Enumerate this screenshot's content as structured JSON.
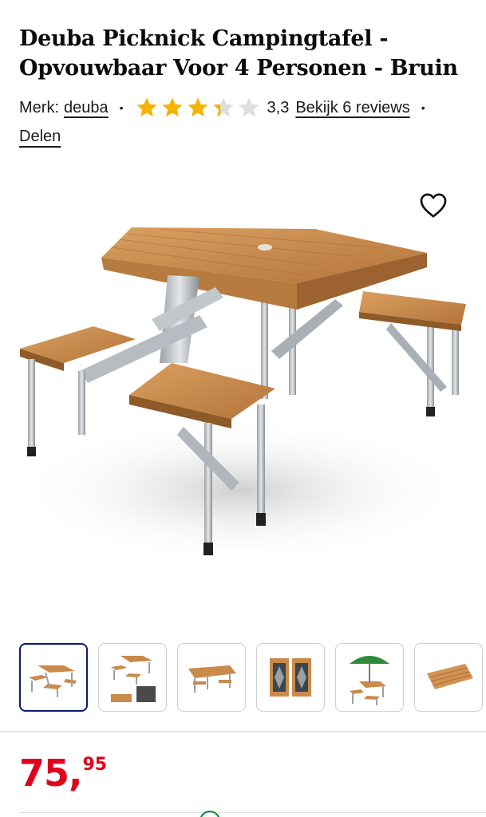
{
  "product": {
    "title": "Deuba Picknick Campingtafel - Opvouwbaar Voor 4 Personen - Bruin",
    "brand_label": "Merk:",
    "brand": "deuba",
    "rating": 3.3,
    "rating_text": "3,3",
    "reviews_link": "Bekijk 6 reviews",
    "share_label": "Delen"
  },
  "gallery": {
    "main_image": "picnic-table-photo",
    "wishlist_icon": "heart-outline-icon",
    "thumbnails": [
      {
        "name": "thumbnail-1",
        "subject": "table-with-benches",
        "active": true
      },
      {
        "name": "thumbnail-2",
        "subject": "table-and-detail-views",
        "active": false
      },
      {
        "name": "thumbnail-3",
        "subject": "table-side-view",
        "active": false
      },
      {
        "name": "thumbnail-4",
        "subject": "folded-case",
        "active": false
      },
      {
        "name": "thumbnail-5",
        "subject": "table-with-umbrella",
        "active": false
      },
      {
        "name": "thumbnail-6",
        "subject": "tabletop",
        "active": false
      }
    ]
  },
  "price": {
    "whole": "75,",
    "cents": "95",
    "color": "#e0001b"
  },
  "colors": {
    "star_filled": "#f5b400",
    "star_empty": "#dedede",
    "active_border": "#0a1a6e",
    "wood": "#c98a4a"
  }
}
